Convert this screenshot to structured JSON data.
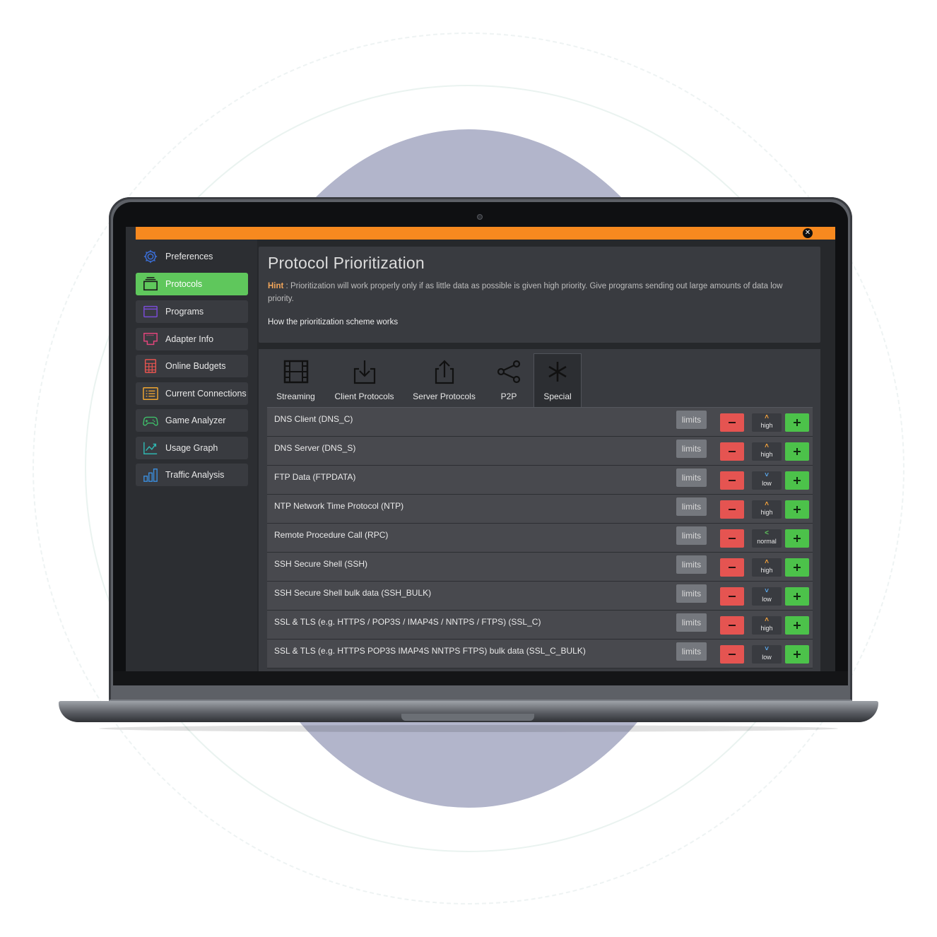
{
  "window": {
    "close_glyph": "✕"
  },
  "sidebar": {
    "items": [
      {
        "label": "Preferences",
        "icon": "gear-icon",
        "color": "#3b6fd8"
      },
      {
        "label": "Protocols",
        "icon": "layers-icon",
        "color": "#1b1b1b",
        "active": true
      },
      {
        "label": "Programs",
        "icon": "window-icon",
        "color": "#7a4cd6"
      },
      {
        "label": "Adapter Info",
        "icon": "network-adapter-icon",
        "color": "#e0457b"
      },
      {
        "label": "Online Budgets",
        "icon": "calculator-icon",
        "color": "#e5544f"
      },
      {
        "label": "Current Connections",
        "icon": "list-icon",
        "color": "#f0a531"
      },
      {
        "label": "Game Analyzer",
        "icon": "gamepad-icon",
        "color": "#3fbf6a"
      },
      {
        "label": "Usage Graph",
        "icon": "line-graph-icon",
        "color": "#2fb6b0"
      },
      {
        "label": "Traffic Analysis",
        "icon": "bar-chart-icon",
        "color": "#3b8fe0"
      }
    ]
  },
  "main": {
    "title": "Protocol Prioritization",
    "hint_label": "Hint",
    "hint_text": " : Prioritization will work properly only if as little data as possible is given high priority. Give programs sending out large amounts of data low priority.",
    "scheme_link": "How the prioritization scheme works"
  },
  "tabs": [
    {
      "label": "Streaming",
      "icon": "film-icon"
    },
    {
      "label": "Client Protocols",
      "icon": "download-icon"
    },
    {
      "label": "Server Protocols",
      "icon": "upload-icon"
    },
    {
      "label": "P2P",
      "icon": "share-icon"
    },
    {
      "label": "Special",
      "icon": "asterisk-icon",
      "active": true
    }
  ],
  "limits_label": "limits",
  "priority_colors": {
    "high": "#f3a23c",
    "low": "#5aa6e8",
    "normal": "#5fc75c"
  },
  "protocols": [
    {
      "name": "DNS Client (DNS_C)",
      "priority": "high"
    },
    {
      "name": "DNS Server (DNS_S)",
      "priority": "high"
    },
    {
      "name": "FTP Data (FTPDATA)",
      "priority": "low"
    },
    {
      "name": "NTP Network Time Protocol (NTP)",
      "priority": "high"
    },
    {
      "name": "Remote Procedure Call (RPC)",
      "priority": "normal"
    },
    {
      "name": "SSH Secure Shell (SSH)",
      "priority": "high"
    },
    {
      "name": "SSH Secure Shell bulk data (SSH_BULK)",
      "priority": "low"
    },
    {
      "name": "SSL & TLS (e.g. HTTPS / POP3S / IMAP4S / NNTPS / FTPS) (SSL_C)",
      "priority": "high"
    },
    {
      "name": "SSL & TLS (e.g. HTTPS POP3S IMAP4S NNTPS FTPS) bulk data (SSL_C_BULK)",
      "priority": "low"
    }
  ]
}
